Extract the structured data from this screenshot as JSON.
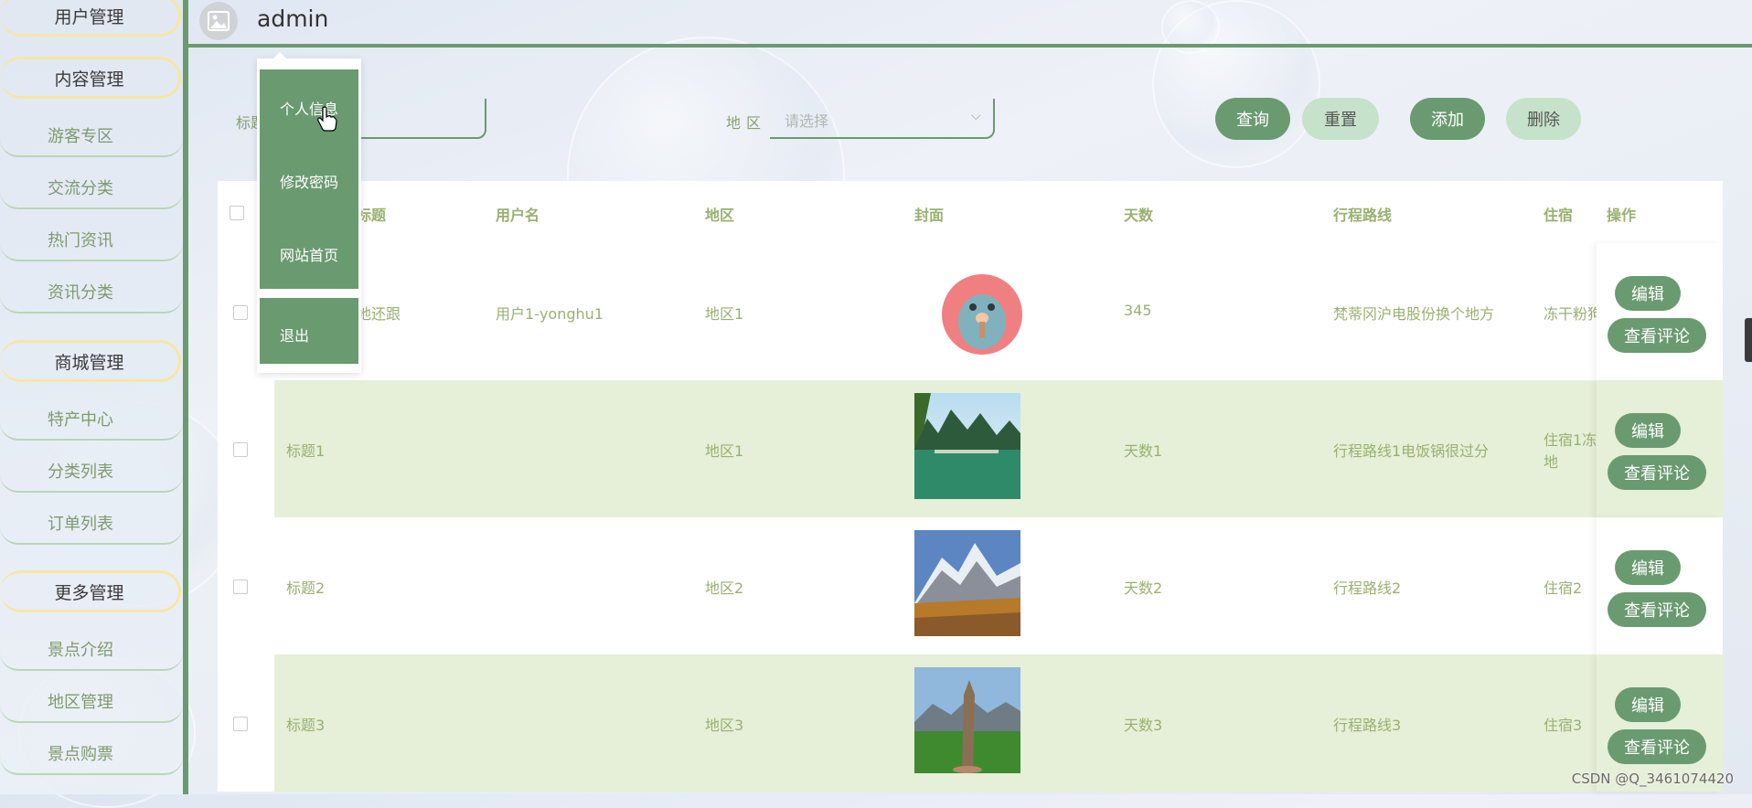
{
  "sidebar": {
    "groups": [
      {
        "title": "用户管理"
      },
      {
        "title": "内容管理",
        "items": [
          "游客专区",
          "交流分类",
          "热门资讯",
          "资讯分类"
        ]
      },
      {
        "title": "商城管理",
        "items": [
          "特产中心",
          "分类列表",
          "订单列表"
        ]
      },
      {
        "title": "更多管理",
        "items": [
          "景点介绍",
          "地区管理",
          "景点购票"
        ]
      }
    ]
  },
  "header": {
    "username": "admin",
    "avatar_icon": "image-placeholder-icon"
  },
  "dropdown": {
    "items": [
      "个人信息",
      "修改密码",
      "网站首页",
      "退出"
    ]
  },
  "search": {
    "title_label": "标题",
    "region_label": "地区",
    "region_placeholder": "请选择",
    "buttons": {
      "query": "查询",
      "reset": "重置",
      "add": "添加",
      "delete": "删除"
    }
  },
  "table": {
    "columns": [
      "标题",
      "用户名",
      "地区",
      "封面",
      "天数",
      "行程路线",
      "住宿",
      "操作"
    ],
    "rows": [
      {
        "title": "地还跟",
        "username": "用户1-yonghu1",
        "region": "地区1",
        "days": "345",
        "route": "梵蒂冈沪电股份换个地方",
        "lodging": "冻干粉狗",
        "cover": "cartoon-avatar"
      },
      {
        "title": "标题1",
        "username": "",
        "region": "地区1",
        "days": "天数1",
        "route": "行程路线1电饭锅很过分",
        "lodging": "住宿1冻",
        "lodging2": "地",
        "cover": "lake-landscape"
      },
      {
        "title": "标题2",
        "username": "",
        "region": "地区2",
        "days": "天数2",
        "route": "行程路线2",
        "lodging": "住宿2",
        "cover": "snow-mountain"
      },
      {
        "title": "标题3",
        "username": "",
        "region": "地区3",
        "days": "天数3",
        "route": "行程路线3",
        "lodging": "住宿3",
        "cover": "tree-meadow"
      }
    ],
    "actions": {
      "edit": "编辑",
      "comments": "查看评论"
    }
  },
  "watermark": "CSDN @Q_3461074420",
  "colors": {
    "primary": "#6a9a70",
    "light": "#c7e2cb",
    "text": "#9ab070",
    "row_alt": "#e6efd8",
    "pill_border": "#f6e6a6"
  }
}
